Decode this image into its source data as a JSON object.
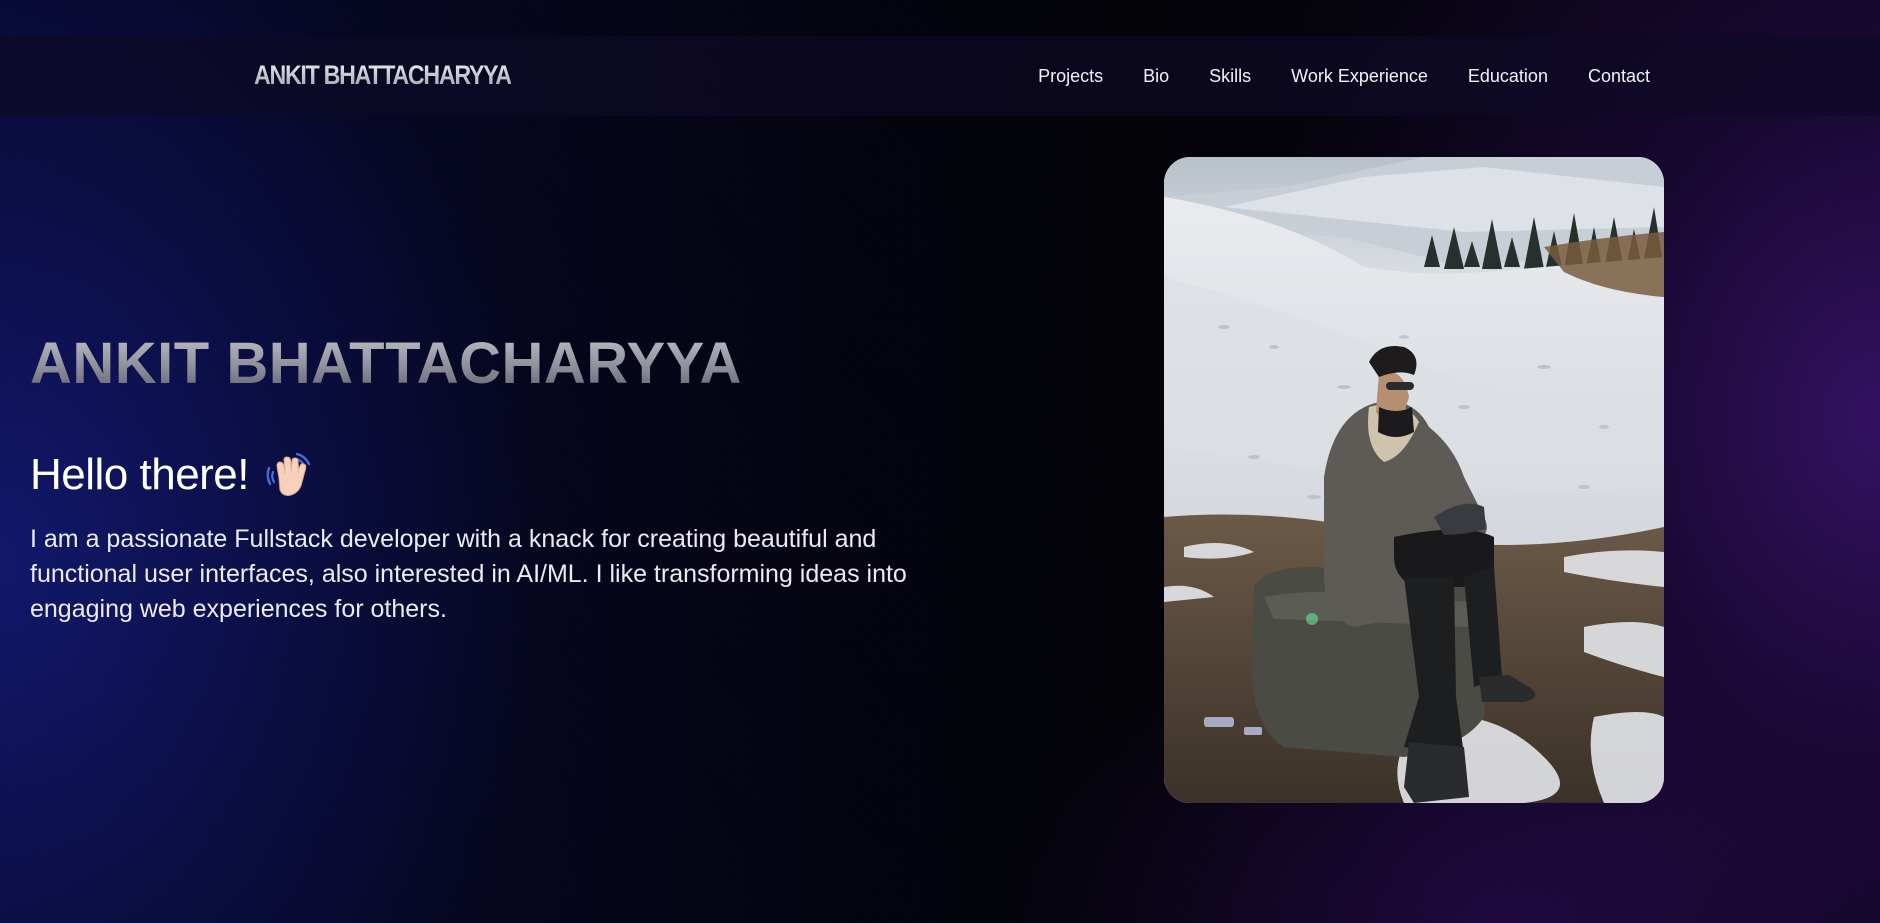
{
  "brand": {
    "name": "ANKIT BHATTACHARYYA"
  },
  "nav": {
    "items": [
      {
        "label": "Projects"
      },
      {
        "label": "Bio"
      },
      {
        "label": "Skills"
      },
      {
        "label": "Work Experience"
      },
      {
        "label": "Education"
      },
      {
        "label": "Contact"
      }
    ]
  },
  "hero": {
    "title": "ANKIT BHATTACHARYYA",
    "greeting": "Hello there!",
    "greeting_icon": "waving-hand-icon",
    "intro": "I am a passionate Fullstack developer with a knack for creating beautiful and functional user interfaces, also interested in AI/ML. I like transforming ideas into engaging web experiences for others."
  },
  "colors": {
    "background_left": "#0c1050",
    "background_center": "#020207",
    "background_right": "#2a0c50",
    "navbar": "#0e0a26",
    "text": "#ffffff"
  }
}
